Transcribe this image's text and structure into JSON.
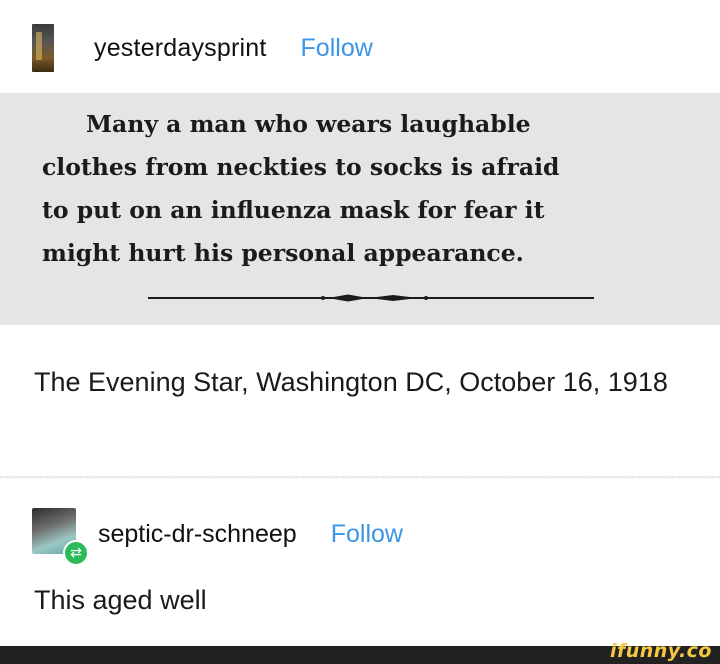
{
  "post": {
    "username": "yesterdaysprint",
    "follow_label": "Follow",
    "clipping_lines": [
      "Many a man who wears laughable",
      "clothes from neckties to socks is afraid",
      "to put on an influenza mask for fear it",
      "might hurt his personal appearance."
    ],
    "caption": "The Evening Star, Washington DC, October 16, 1918"
  },
  "reblog": {
    "username": "septic-dr-schneep",
    "follow_label": "Follow",
    "comment": "This aged well"
  },
  "watermark": "ifunny.co",
  "colors": {
    "follow": "#3b95e8",
    "clipping_bg": "#e5e5e3",
    "reblog_badge": "#2dbb59"
  }
}
